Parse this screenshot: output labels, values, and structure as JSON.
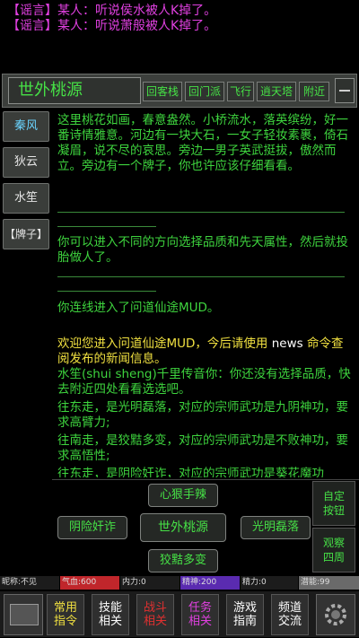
{
  "rumors": [
    {
      "tag": "【谣言】",
      "text": "某人：听说侯水被人K掉了。"
    },
    {
      "tag": "【谣言】",
      "text": "某人：听说萧般被人K掉了。"
    }
  ],
  "room": {
    "name": "世外桃源",
    "exits": [
      "回客栈",
      "回门派",
      "飞行",
      "逍天塔",
      "附近"
    ]
  },
  "npcs": [
    "秦风",
    "狄云",
    "水笙",
    "【牌子】"
  ],
  "description": "这里桃花如画，春意盎然。小桥流水，落英缤纷，好一番诗情雅意。河边有一块大石，一女子轻妆素裹，倚石凝眉，说不尽的哀思。旁边一男子英武挺拔，傲然而立。旁边有一个牌子，你也许应该仔细看看。",
  "messages": {
    "choose_info": "你可以进入不同的方向选择品质和先天属性，然后就投胎做人了。",
    "connected": "你连线进入了问道仙途MUD。",
    "welcome_pre": "欢迎您进入问道仙途MUD，今后请使用 ",
    "welcome_cmd": "news",
    "welcome_post": " 命令查阅发布的新闻信息。",
    "tell": "水笙(shui sheng)千里传音你：你还没有选择品质，快去附近四处看看选选吧。",
    "east": "往东走，是光明磊落，对应的宗师武功是九阴神功，要求高臂力;",
    "south": "往南走，是狡黠多变，对应的宗师武功是不败神功，要求高悟性;",
    "west_partial": "往东走，是阴险奸诈，对应的宗师武功是葵花魔功"
  },
  "skills": {
    "north": "心狠手辣",
    "west": "阴险奸诈",
    "center": "世外桃源",
    "east": "光明磊落",
    "south": "狡黠多变"
  },
  "side_buttons": {
    "custom": [
      "自定",
      "按钮"
    ],
    "observe": [
      "观察",
      "四周"
    ]
  },
  "status": {
    "nickname": "昵称:不见",
    "qixue": "气血:600",
    "neili": "内力:0",
    "jingshen": "精神:200",
    "jingli": "精力:0",
    "qianneng": "潜能:99"
  },
  "bottom_nav": [
    {
      "l1": "常用",
      "l2": "指令",
      "color": "#f0e040"
    },
    {
      "l1": "技能",
      "l2": "相关",
      "color": "#ffffff"
    },
    {
      "l1": "战斗",
      "l2": "相关",
      "color": "#e03030"
    },
    {
      "l1": "任务",
      "l2": "相关",
      "color": "#e040e0"
    },
    {
      "l1": "游戏",
      "l2": "指南",
      "color": "#ffffff"
    },
    {
      "l1": "频道",
      "l2": "交流",
      "color": "#ffffff"
    }
  ],
  "colors": {
    "accent": "#46e046",
    "rumor": "#e040e0",
    "hp": "#c0262b",
    "mp": "#5a2bb0"
  }
}
